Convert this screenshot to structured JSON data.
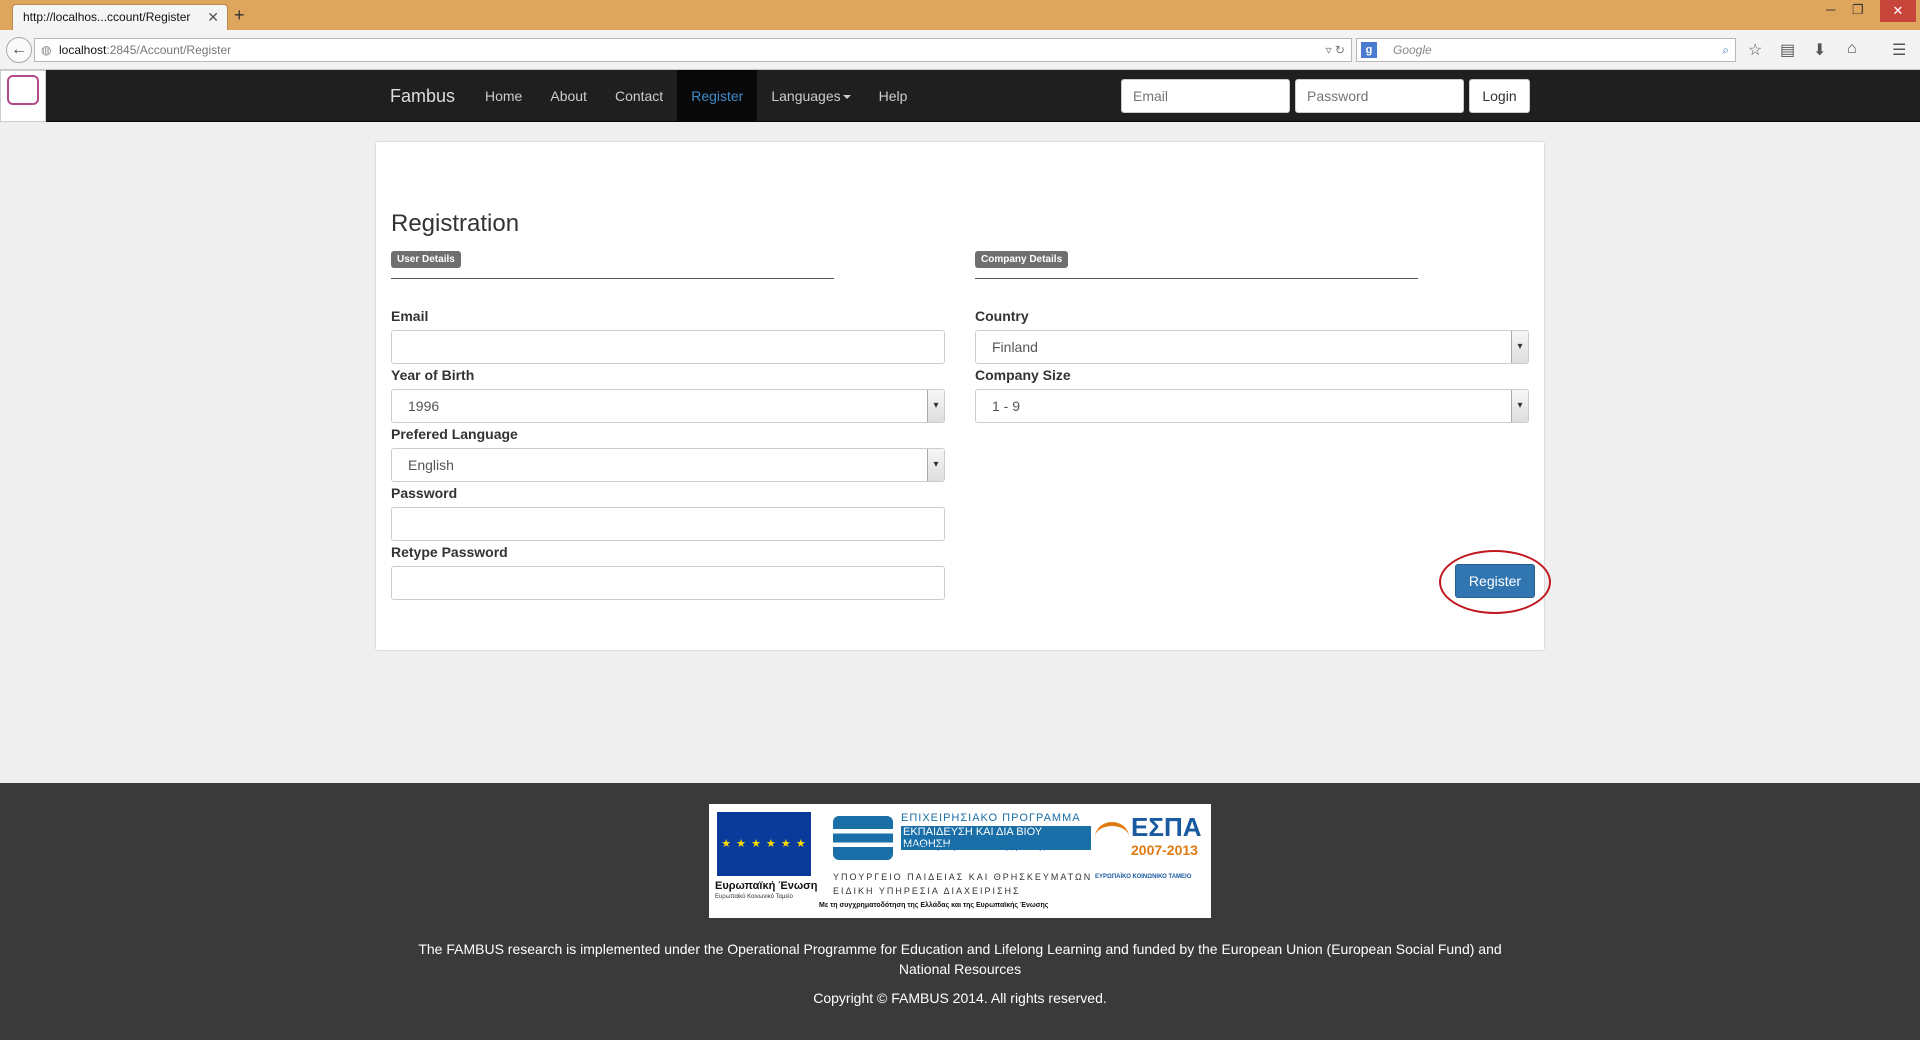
{
  "browser": {
    "tab_title": "http://localhos...ccount/Register",
    "tab_close": "✕",
    "new_tab": "+",
    "url_host": "localhost",
    "url_path": ":2845/Account/Register",
    "search_placeholder": "Google",
    "search_engine_icon": "g-icon"
  },
  "nav": {
    "brand": "Fambus",
    "links": [
      {
        "label": "Home"
      },
      {
        "label": "About"
      },
      {
        "label": "Contact"
      },
      {
        "label": "Register",
        "active": true
      },
      {
        "label": "Languages"
      },
      {
        "label": "Help"
      }
    ],
    "email_placeholder": "Email",
    "password_placeholder": "Password",
    "login_label": "Login"
  },
  "form": {
    "title": "Registration",
    "user_section": "User Details",
    "company_section": "Company Details",
    "email_label": "Email",
    "email_value": "",
    "year_label": "Year of Birth",
    "year_value": "1996",
    "language_label": "Prefered Language",
    "language_value": "English",
    "password_label": "Password",
    "retype_label": "Retype Password",
    "country_label": "Country",
    "country_value": "Finland",
    "company_size_label": "Company Size",
    "company_size_value": "1 - 9",
    "register_label": "Register"
  },
  "footer": {
    "eu_label": "Ευρωπαϊκή Ένωση",
    "eu_sub": "Ευρωπαϊκό Κοινωνικό Ταμείο",
    "op_line1": "ΕΠΙΧΕΙΡΗΣΙΑΚΟ ΠΡΟΓΡΑΜΜΑ",
    "op_line2": "ΕΚΠΑΙΔΕΥΣΗ ΚΑΙ ΔΙΑ ΒΙΟΥ ΜΑΘΗΣΗ",
    "op_line3": "επένδυση στην κοινωνία της γνώσης",
    "op_line4": "ΥΠΟΥΡΓΕΙΟ ΠΑΙΔΕΙΑΣ ΚΑΙ ΘΡΗΣΚΕΥΜΑΤΩΝ",
    "op_line5": "ΕΙΔΙΚΗ ΥΠΗΡΕΣΙΑ ΔΙΑΧΕΙΡΙΣΗΣ",
    "cofund": "Με τη συγχρηματοδότηση της Ελλάδας και της Ευρωπαϊκής Ένωσης",
    "espa_title": "ΕΣΠΑ",
    "espa_years": "2007-2013",
    "espa_sub": "ΕΥΡΩΠΑΪΚΟ ΚΟΙΝΩΝΙΚΟ ΤΑΜΕΙΟ",
    "text": "The FAMBUS research is implemented under the Operational Programme for Education and Lifelong Learning and funded by the European Union (European Social Fund) and National Resources",
    "copyright": "Copyright © FAMBUS 2014. All rights reserved."
  },
  "colors": {
    "nav_bg": "#1f1f1f",
    "accent": "#428bca",
    "button_primary": "#3276b1",
    "highlight": "#c0181e"
  }
}
